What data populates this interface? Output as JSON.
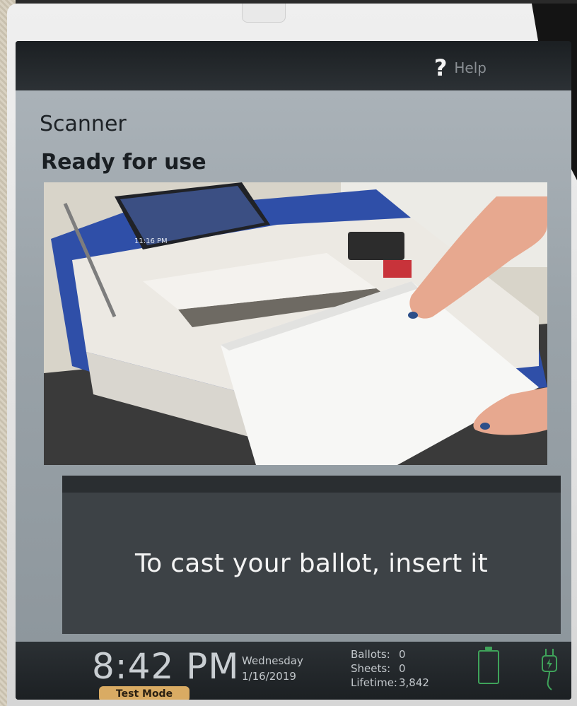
{
  "header": {
    "help_label": "Help",
    "help_icon": "question-mark-icon"
  },
  "main": {
    "subtitle": "Scanner",
    "title": "Ready for use",
    "instruction": "To cast your ballot, insert it"
  },
  "illustration": {
    "screen_time": "11:16 PM"
  },
  "status": {
    "time": "8:42 PM",
    "mode_badge": "Test Mode",
    "day": "Wednesday",
    "date": "1/16/2019",
    "ballots_label": "Ballots:",
    "ballots_value": "0",
    "sheets_label": "Sheets:",
    "sheets_value": "0",
    "lifetime_label": "Lifetime:",
    "lifetime_value": "3,842",
    "battery_icon": "battery-icon",
    "plug_icon": "power-plug-icon"
  },
  "colors": {
    "badge": "#d9ab63",
    "battery": "#3fa35a",
    "panel": "#3d4246"
  }
}
